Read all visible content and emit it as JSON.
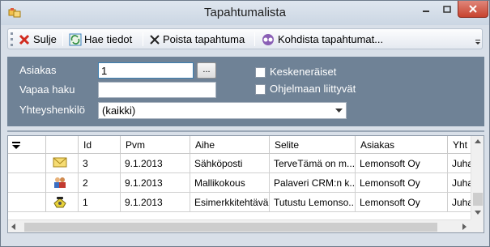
{
  "window": {
    "title": "Tapahtumalista"
  },
  "toolbar": {
    "close_label": "Sulje",
    "fetch_label": "Hae tiedot",
    "delete_label": "Poista tapahtuma",
    "assign_label": "Kohdista tapahtumat..."
  },
  "filter": {
    "customer_label": "Asiakas",
    "customer_value": "1",
    "ellipsis_label": "...",
    "freesearch_label": "Vapaa haku",
    "freesearch_value": "",
    "contact_label": "Yhteyshenkilö",
    "contact_value": "(kaikki)",
    "unfinished_label": "Keskeneräiset",
    "program_label": "Ohjelmaan liittyvät"
  },
  "grid": {
    "columns": [
      "Id",
      "Pvm",
      "Aihe",
      "Selite",
      "Asiakas",
      "Yht"
    ],
    "rows": [
      {
        "icon": "envelope-icon",
        "id": "3",
        "date": "9.1.2013",
        "subject": "Sähköposti",
        "desc": "TerveTämä on m...",
        "customer": "Lemonsoft Oy",
        "contact": "Juha"
      },
      {
        "icon": "meeting-icon",
        "id": "2",
        "date": "9.1.2013",
        "subject": "Mallikokous",
        "desc": "Palaveri CRM:n k...",
        "customer": "Lemonsoft Oy",
        "contact": "Juha"
      },
      {
        "icon": "phone-icon",
        "id": "1",
        "date": "9.1.2013",
        "subject": "Esimerkkitehtävä",
        "desc": "Tutustu Lemonso...",
        "customer": "Lemonsoft Oy",
        "contact": "Juha"
      }
    ]
  },
  "colors": {
    "filter_bg": "#6f8296",
    "close_button": "#c7432f"
  }
}
